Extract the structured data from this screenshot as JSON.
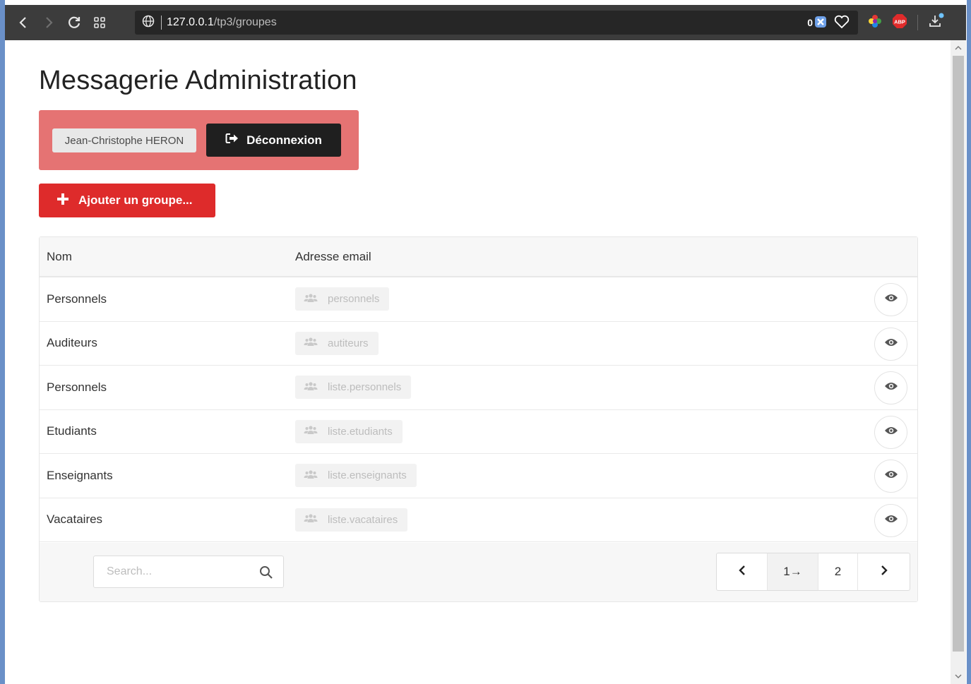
{
  "browser": {
    "url_host": "127.0.0.1",
    "url_path": "/tp3/groupes",
    "badge_count": "0"
  },
  "page": {
    "title": "Messagerie Administration",
    "user_name": "Jean-Christophe HERON",
    "logout_label": "Déconnexion",
    "add_group_label": "Ajouter un groupe..."
  },
  "table": {
    "headers": {
      "name": "Nom",
      "email": "Adresse email"
    },
    "rows": [
      {
        "name": "Personnels",
        "email": "personnels"
      },
      {
        "name": "Auditeurs",
        "email": "autiteurs"
      },
      {
        "name": "Personnels",
        "email": "liste.personnels"
      },
      {
        "name": "Etudiants",
        "email": "liste.etudiants"
      },
      {
        "name": "Enseignants",
        "email": "liste.enseignants"
      },
      {
        "name": "Vacataires",
        "email": "liste.vacataires"
      }
    ]
  },
  "footer": {
    "search_placeholder": "Search...",
    "pagination": {
      "current": "1→",
      "next_page": "2"
    }
  },
  "colors": {
    "user_panel": "#e57373",
    "add_button": "#de2b2b",
    "logout_button": "#1f1f1f"
  }
}
